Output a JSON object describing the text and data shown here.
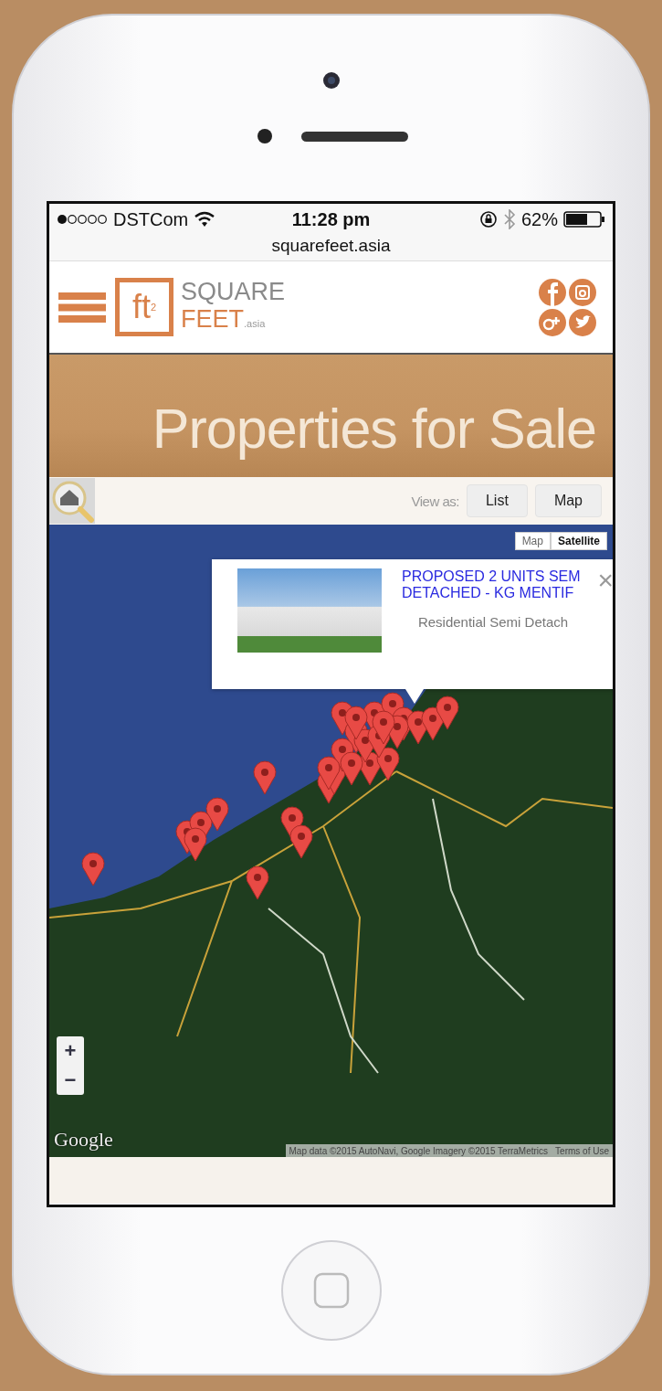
{
  "status_bar": {
    "carrier": "DSTCom",
    "time": "11:28 pm",
    "battery": "62%",
    "url": "squarefeet.asia"
  },
  "header": {
    "logo_mark": "ft$^{2}$",
    "logo_line_1": "SQUARE",
    "logo_line_2": "FEET",
    "logo_suffix": ".asia"
  },
  "banner": {
    "title": "Properties for Sale"
  },
  "toolbar": {
    "label": "View as:",
    "buttons": [
      {
        "label": "List"
      },
      {
        "label": "Map"
      }
    ]
  },
  "map": {
    "type_buttons": [
      {
        "label": "Map",
        "selected": false
      },
      {
        "label": "Satellite",
        "selected": true
      }
    ],
    "info_window": {
      "title": "PROPOSED 2 UNITS SEM\nDETACHED - KG MENTIF",
      "subtitle": "Residential Semi Detach",
      "close": "×"
    },
    "zoom": [
      "+",
      "−"
    ],
    "logo": "Google",
    "attribution": "Map data ©2015 AutoNavi, Google Imagery ©2015 TerraMetrics",
    "terms": "Terms of Use"
  }
}
